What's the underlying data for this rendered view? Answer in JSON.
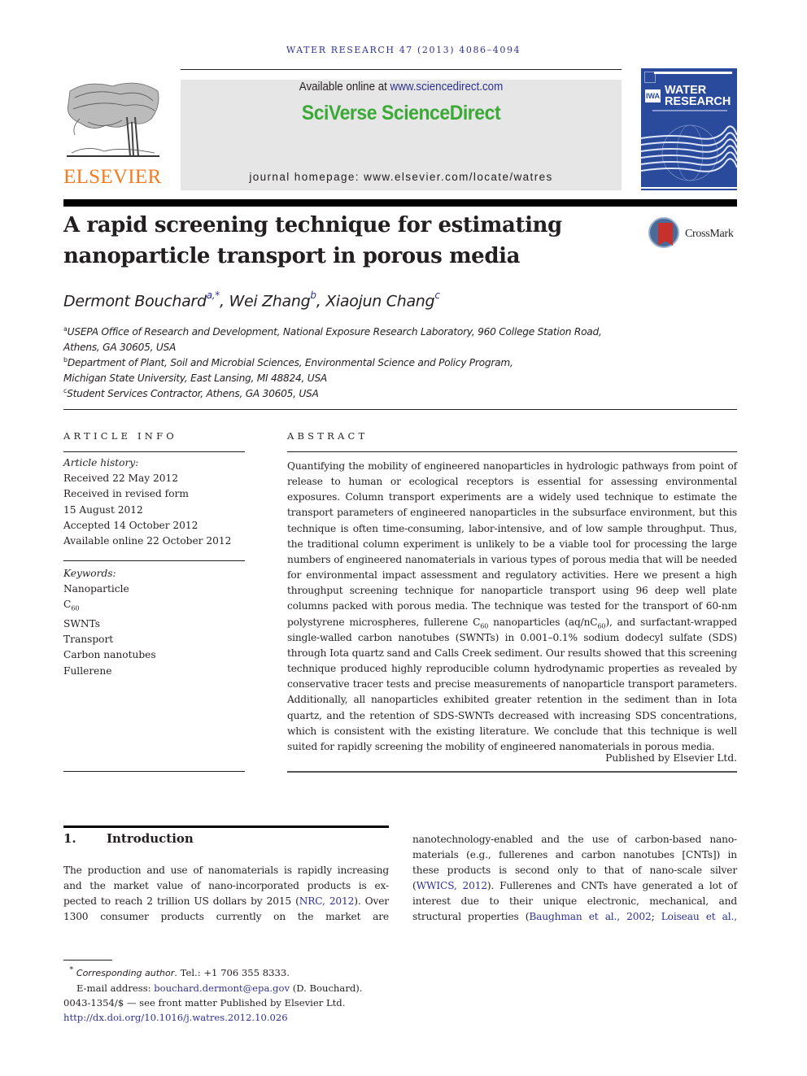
{
  "running_head": "WATER RESEARCH 47 (2013) 4086–4094",
  "header": {
    "publisher_logo": "ELSEVIER",
    "available_online_prefix": "Available online at ",
    "available_online_link": "www.sciencedirect.com",
    "brand": "SciVerse ScienceDirect",
    "journal_homepage": "journal homepage: www.elsevier.com/locate/watres",
    "cover": {
      "publisher_mark": "IWA",
      "title_line1": "WATER",
      "title_line2": "RESEARCH"
    },
    "colors": {
      "elsevier_orange": "#f47b20",
      "sciencedirect_green": "#3aa935",
      "link_blue": "#2e3192",
      "cover_blue": "#2a4a9c"
    }
  },
  "article": {
    "title": "A rapid screening technique for estimating nanoparticle transport in porous media",
    "crossmark_label": "CrossMark",
    "authors": [
      {
        "name": "Dermont Bouchard",
        "marks": "a,*"
      },
      {
        "name": "Wei Zhang",
        "marks": "b"
      },
      {
        "name": "Xiaojun Chang",
        "marks": "c"
      }
    ],
    "affiliations": [
      {
        "mark": "a",
        "line1": "USEPA Office of Research and Development, National Exposure Research Laboratory, 960 College Station Road,",
        "line2": "Athens, GA 30605, USA"
      },
      {
        "mark": "b",
        "line1": "Department of Plant, Soil and Microbial Sciences, Environmental Science and Policy Program,",
        "line2": "Michigan State University, East Lansing, MI 48824, USA"
      },
      {
        "mark": "c",
        "line1": "Student Services Contractor, Athens, GA 30605, USA",
        "line2": ""
      }
    ]
  },
  "article_info": {
    "heading": "ARTICLE INFO",
    "history_label": "Article history:",
    "history": [
      "Received 22 May 2012",
      "Received in revised form",
      "15 August 2012",
      "Accepted 14 October 2012",
      "Available online 22 October 2012"
    ],
    "keywords_label": "Keywords:",
    "keywords": [
      "Nanoparticle",
      "C60",
      "SWNTs",
      "Transport",
      "Carbon nanotubes",
      "Fullerene"
    ]
  },
  "abstract": {
    "heading": "ABSTRACT",
    "part1": "Quantifying the mobility of engineered nanoparticles in hydrologic pathways from point of release to human or ecological receptors is essential for assessing environmental exposures. Column transport experiments are a widely used technique to estimate the transport parameters of engineered nanoparticles in the subsurface environment, but this technique is often time-consuming, labor-intensive, and of low sample throughput. Thus, the traditional column experiment is unlikely to be a viable tool for processing the large numbers of engineered nanomaterials in various types of porous media that will be needed for environmental impact assessment and regulatory activities. Here we present a high throughput screening technique for nanoparticle transport using 96 deep well plate columns packed with porous media. The technique was tested for the transport of 60-nm polystyrene microspheres, fullerene C",
    "sub1": "60",
    "part2": " nanoparticles (aq/nC",
    "sub2": "60",
    "part3": "), and surfactant-wrapped single-walled carbon nanotubes (SWNTs) in 0.001–0.1% sodium dodecyl sulfate (SDS) through Iota quartz sand and Calls Creek sediment. Our results showed that this screening technique produced highly reproducible column hydrodynamic properties as revealed by conservative tracer tests and precise measurements of nanoparticle transport parameters. Additionally, all nanoparticles exhibited greater retention in the sediment than in Iota quartz, and the retention of SDS-SWNTs decreased with increasing SDS concentrations, which is consistent with the existing literature. We conclude that this technique is well suited for rapidly screening the mobility of engineered nanomaterials in porous media.",
    "publisher_note": "Published by Elsevier Ltd."
  },
  "introduction": {
    "number": "1.",
    "heading": "Introduction",
    "left_lines": [
      {
        "text": "The production and use of nanomaterials is rapidly increasing"
      },
      {
        "text": "and the market value of nano-incorporated products is ex-"
      },
      {
        "pre": "pected to reach 2 trillion US dollars by 2015 (",
        "link": "NRC, 2012",
        "post": "). Over"
      },
      {
        "text": "1300 consumer products currently on the market are"
      }
    ],
    "right_lines": [
      {
        "text": "nanotechnology-enabled and the use of carbon-based nano-"
      },
      {
        "text": "materials (e.g., fullerenes and carbon nanotubes [CNTs]) in"
      },
      {
        "text": "these products is second only to that of nano-scale silver"
      },
      {
        "pre": "(",
        "link": "WWICS, 2012",
        "post": "). Fullerenes and CNTs have generated a lot of"
      },
      {
        "text": "interest due to their unique electronic, mechanical, and"
      },
      {
        "pre": "structural properties (",
        "link": "Baughman et al., 2002",
        "mid": "; ",
        "link2": "Loiseau et al.,",
        "post": ""
      }
    ]
  },
  "footnotes": {
    "star": "*",
    "corresponding_label": "Corresponding author",
    "tel": ". Tel.: +1 706 355 8333.",
    "email_prefix": "E-mail address: ",
    "email": "bouchard.dermont@epa.gov",
    "email_suffix": " (D. Bouchard).",
    "issn_line": "0043-1354/$ — see front matter Published by Elsevier Ltd.",
    "doi": "http://dx.doi.org/10.1016/j.watres.2012.10.026"
  }
}
